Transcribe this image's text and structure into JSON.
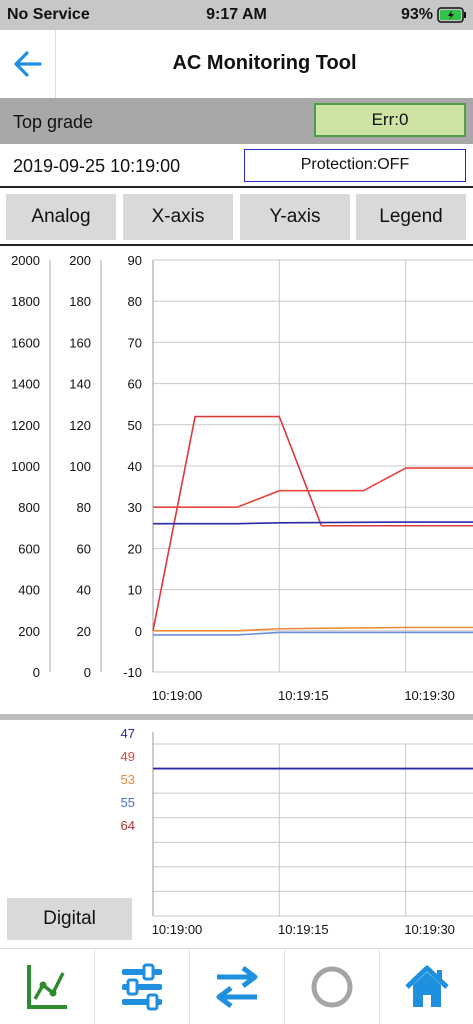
{
  "status_bar": {
    "carrier": "No Service",
    "time": "9:17 AM",
    "battery": "93%"
  },
  "nav": {
    "title": "AC Monitoring Tool"
  },
  "grade": {
    "label": "Top grade",
    "error": "Err:0"
  },
  "info": {
    "datetime": "2019-09-25 10:19:00",
    "protection": "Protection:OFF"
  },
  "tabs": [
    {
      "label": "Analog"
    },
    {
      "label": "X-axis"
    },
    {
      "label": "Y-axis"
    },
    {
      "label": "Legend"
    }
  ],
  "digital_button": "Digital",
  "colors": {
    "accent": "#1f8fe0",
    "err_bg": "#cde4a5",
    "err_border": "#4f9d4a",
    "protection_border": "#2a2ac0",
    "toolbar_active": "#2e8b2e"
  },
  "toolbar": {
    "icons": [
      "line-chart-icon",
      "sliders-icon",
      "swap-arrows-icon",
      "circle-icon",
      "home-icon"
    ]
  },
  "chart_data": [
    {
      "type": "line",
      "y_axes": [
        {
          "ticks": [
            "2000",
            "1800",
            "1600",
            "1400",
            "1200",
            "1000",
            "800",
            "600",
            "400",
            "200",
            "0"
          ],
          "ylim": [
            0,
            2000
          ]
        },
        {
          "ticks": [
            "200",
            "180",
            "160",
            "140",
            "120",
            "100",
            "80",
            "60",
            "40",
            "20",
            "0"
          ],
          "ylim": [
            0,
            200
          ]
        },
        {
          "ticks": [
            "90",
            "80",
            "70",
            "60",
            "50",
            "40",
            "30",
            "20",
            "10",
            "0",
            "-10"
          ],
          "ylim": [
            -10,
            90
          ]
        }
      ],
      "x_ticks": [
        "10:19:00",
        "10:19:15",
        "10:19:30"
      ],
      "x_range_seconds": [
        0,
        38
      ],
      "grid": true,
      "series": [
        {
          "color": "#d93a3a",
          "x": [
            0,
            5,
            15,
            20
          ],
          "y": [
            0,
            52,
            52,
            25.5
          ]
        },
        {
          "color": "#d93a3a",
          "x": [
            20,
            38
          ],
          "y": [
            25.5,
            25.5
          ]
        },
        {
          "color": "#e8453c",
          "x": [
            0,
            10,
            15,
            25,
            30,
            38
          ],
          "y": [
            30,
            30,
            34,
            34,
            39.5,
            39.5
          ]
        },
        {
          "color": "#2a2aa8",
          "x": [
            0,
            10,
            15,
            30,
            38
          ],
          "y": [
            26,
            26,
            26.2,
            26.4,
            26.4
          ]
        },
        {
          "color": "#ef8a3a",
          "x": [
            0,
            10,
            15,
            30,
            38
          ],
          "y": [
            0,
            0,
            0.5,
            0.8,
            0.8
          ]
        },
        {
          "color": "#6a8fd8",
          "x": [
            0,
            10,
            15,
            30,
            38
          ],
          "y": [
            -1,
            -1,
            -0.4,
            -0.4,
            -0.4
          ]
        }
      ]
    },
    {
      "type": "line",
      "legend": [
        {
          "label": "47",
          "color": "#2a2aa8"
        },
        {
          "label": "49",
          "color": "#e8453c"
        },
        {
          "label": "53",
          "color": "#ef8a3a"
        },
        {
          "label": "55",
          "color": "#4a6fd0"
        },
        {
          "label": "64",
          "color": "#b03030"
        }
      ],
      "x_ticks": [
        "10:19:00",
        "10:19:15",
        "10:19:30"
      ],
      "x_range_seconds": [
        0,
        38
      ],
      "grid": true,
      "series": [
        {
          "color": "#2a2aa8",
          "x": [
            0,
            38
          ],
          "level": 1
        }
      ]
    }
  ]
}
